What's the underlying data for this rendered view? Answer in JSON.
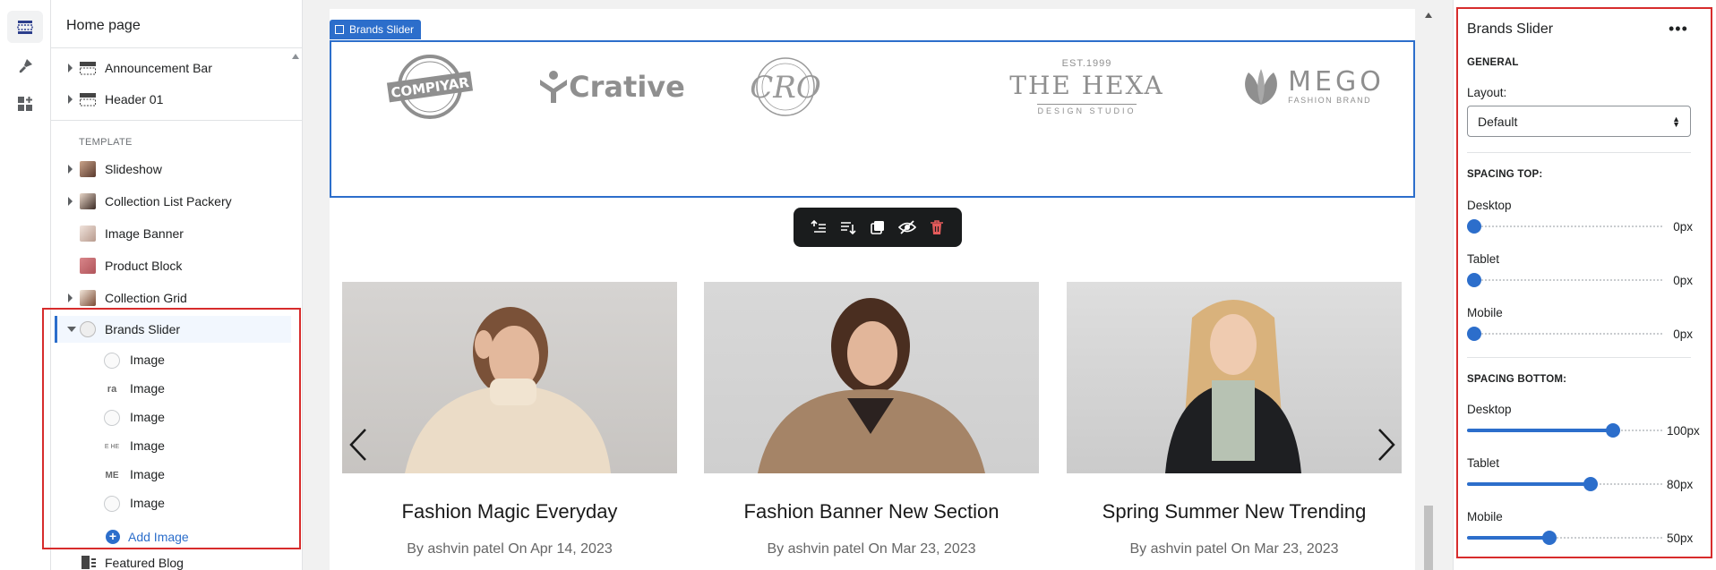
{
  "sidebar": {
    "title": "Home page",
    "top_items": [
      {
        "label": "Announcement Bar"
      },
      {
        "label": "Header 01"
      }
    ],
    "template_label": "TEMPLATE",
    "template_items": [
      {
        "label": "Slideshow"
      },
      {
        "label": "Collection List Packery"
      },
      {
        "label": "Image Banner"
      },
      {
        "label": "Product Block"
      },
      {
        "label": "Collection Grid"
      },
      {
        "label": "Brands Slider"
      }
    ],
    "children": [
      {
        "label": "Image"
      },
      {
        "label": "Image"
      },
      {
        "label": "Image"
      },
      {
        "label": "Image"
      },
      {
        "label": "Image"
      },
      {
        "label": "Image"
      }
    ],
    "child_thumb_text": [
      "",
      "ra",
      "",
      "E HE",
      "ME",
      ""
    ],
    "add_image_label": "Add Image",
    "featured_label": "Featured Blog"
  },
  "preview": {
    "brands_tag": "Brands Slider",
    "brands": [
      {
        "name": "COMPIYAR"
      },
      {
        "name": "Crative"
      },
      {
        "name": "CRO"
      },
      {
        "name": "THE HEXA",
        "top": "EST.1999",
        "sub": "DESIGN STUDIO"
      },
      {
        "name": "MEGO",
        "sub": "FASHION BRAND"
      }
    ],
    "cards": [
      {
        "title": "Fashion Magic Everyday",
        "meta": "By ashvin patel On Apr 14, 2023"
      },
      {
        "title": "Fashion Banner New Section",
        "meta": "By ashvin patel On Mar 23, 2023"
      },
      {
        "title": "Spring Summer New Trending",
        "meta": "By ashvin patel On Mar 23, 2023"
      }
    ]
  },
  "settings": {
    "title": "Brands Slider",
    "menu": "•••",
    "general_head": "GENERAL",
    "layout_label": "Layout:",
    "layout_value": "Default",
    "spacing_top_head": "SPACING TOP:",
    "spacing_bottom_head": "SPACING BOTTOM:",
    "spacing_top": [
      {
        "label": "Desktop",
        "value": "0px",
        "fraction": 0
      },
      {
        "label": "Tablet",
        "value": "0px",
        "fraction": 0
      },
      {
        "label": "Mobile",
        "value": "0px",
        "fraction": 0
      }
    ],
    "spacing_bottom": [
      {
        "label": "Desktop",
        "value": "100px",
        "fraction": 0.74
      },
      {
        "label": "Tablet",
        "value": "80px",
        "fraction": 0.62
      },
      {
        "label": "Mobile",
        "value": "50px",
        "fraction": 0.4
      }
    ]
  },
  "colors": {
    "accent": "#2c6ecb",
    "highlight_box": "#d72c2c",
    "toolbar_bg": "#1a1c1d",
    "delete": "#e55b5b"
  }
}
